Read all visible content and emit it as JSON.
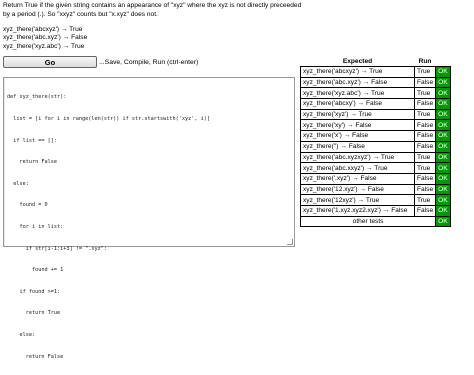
{
  "description": "Return True if the given string contains an appearance of \"xyz\" where the xyz is not directly preceeded by a period (.). So \"xxyz\" counts but \"x.xyz\" does not.",
  "examples": [
    "xyz_there('abcxyz') → True",
    "xyz_there('abc.xyz') → False",
    "xyz_there('xyz.abc') → True"
  ],
  "go_button": "Go",
  "go_hint": "...Save, Compile, Run (ctrl-enter)",
  "code_lines": [
    "def xyz_there(str):",
    "  list = [i for i in range(len(str)) if str.startswith('xyz', i)]",
    "  if list == []:",
    "    return False",
    "  else:",
    "    found = 0",
    "    for i in list:",
    "      if str[i-1:i+3] != \".xyz\":",
    "        found += 1",
    "    if found >=1:",
    "      return True",
    "    else:",
    "      return False"
  ],
  "results": {
    "headers": {
      "expected": "Expected",
      "run": "Run"
    },
    "rows": [
      {
        "expected": "xyz_there('abcxyz') → True",
        "run": "True",
        "status": "OK"
      },
      {
        "expected": "xyz_there('abc.xyz') → False",
        "run": "False",
        "status": "OK"
      },
      {
        "expected": "xyz_there('xyz.abc') → True",
        "run": "True",
        "status": "OK"
      },
      {
        "expected": "xyz_there('abcxy') → False",
        "run": "False",
        "status": "OK"
      },
      {
        "expected": "xyz_there('xyz') → True",
        "run": "True",
        "status": "OK"
      },
      {
        "expected": "xyz_there('xy') → False",
        "run": "False",
        "status": "OK"
      },
      {
        "expected": "xyz_there('x') → False",
        "run": "False",
        "status": "OK"
      },
      {
        "expected": "xyz_there('') → False",
        "run": "False",
        "status": "OK"
      },
      {
        "expected": "xyz_there('abc.xyzxyz') → True",
        "run": "True",
        "status": "OK"
      },
      {
        "expected": "xyz_there('abc.xxyz') → True",
        "run": "True",
        "status": "OK"
      },
      {
        "expected": "xyz_there('.xyz') → False",
        "run": "False",
        "status": "OK"
      },
      {
        "expected": "xyz_there('12.xyz') → False",
        "run": "False",
        "status": "OK"
      },
      {
        "expected": "xyz_there('12xyz') → True",
        "run": "True",
        "status": "OK"
      },
      {
        "expected": "xyz_there('1.xyz.xyz2.xyz') → False",
        "run": "False",
        "status": "OK"
      }
    ],
    "other_tests": {
      "label": "other tests",
      "status": "OK"
    }
  },
  "colors": {
    "ok_green": "#009900"
  }
}
